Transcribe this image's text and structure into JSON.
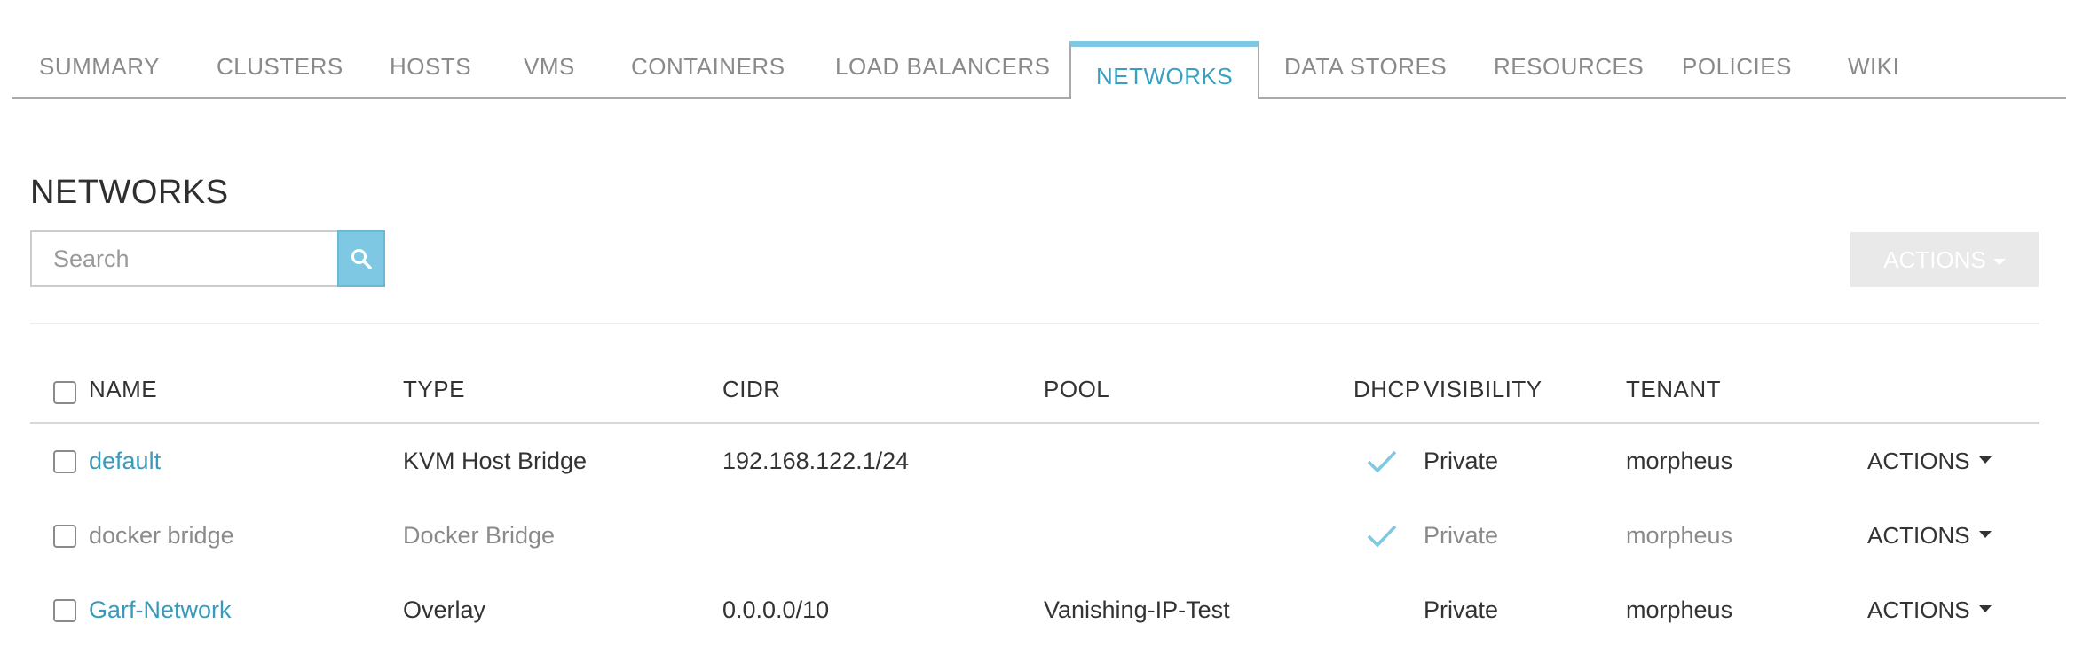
{
  "tabs": [
    {
      "label": "SUMMARY"
    },
    {
      "label": "CLUSTERS"
    },
    {
      "label": "HOSTS"
    },
    {
      "label": "VMS"
    },
    {
      "label": "CONTAINERS"
    },
    {
      "label": "LOAD BALANCERS"
    },
    {
      "label": "NETWORKS"
    },
    {
      "label": "DATA STORES"
    },
    {
      "label": "RESOURCES"
    },
    {
      "label": "POLICIES"
    },
    {
      "label": "WIKI"
    }
  ],
  "active_tab": "NETWORKS",
  "page": {
    "title": "NETWORKS"
  },
  "search": {
    "placeholder": "Search",
    "value": "",
    "icon": "search-icon"
  },
  "toolbar": {
    "actions_label": "ACTIONS"
  },
  "table": {
    "columns": {
      "name": "NAME",
      "type": "TYPE",
      "cidr": "CIDR",
      "pool": "POOL",
      "dhcp": "DHCP",
      "visibility": "VISIBILITY",
      "tenant": "TENANT"
    },
    "rows": [
      {
        "name": "default",
        "type": "KVM Host Bridge",
        "cidr": "192.168.122.1/24",
        "pool": "",
        "dhcp": true,
        "visibility": "Private",
        "tenant": "morpheus",
        "actions": "ACTIONS"
      },
      {
        "name": "docker bridge",
        "type": "Docker Bridge",
        "cidr": "",
        "pool": "",
        "dhcp": true,
        "visibility": "Private",
        "tenant": "morpheus",
        "actions": "ACTIONS"
      },
      {
        "name": "Garf-Network",
        "type": "Overlay",
        "cidr": "0.0.0.0/10",
        "pool": "Vanishing-IP-Test",
        "dhcp": false,
        "visibility": "Private",
        "tenant": "morpheus",
        "actions": "ACTIONS"
      }
    ]
  },
  "colors": {
    "accent": "#7ec8e3",
    "link": "#3a9abb",
    "muted": "#8a8a8a",
    "disabled_button": "#e9e9e9"
  }
}
